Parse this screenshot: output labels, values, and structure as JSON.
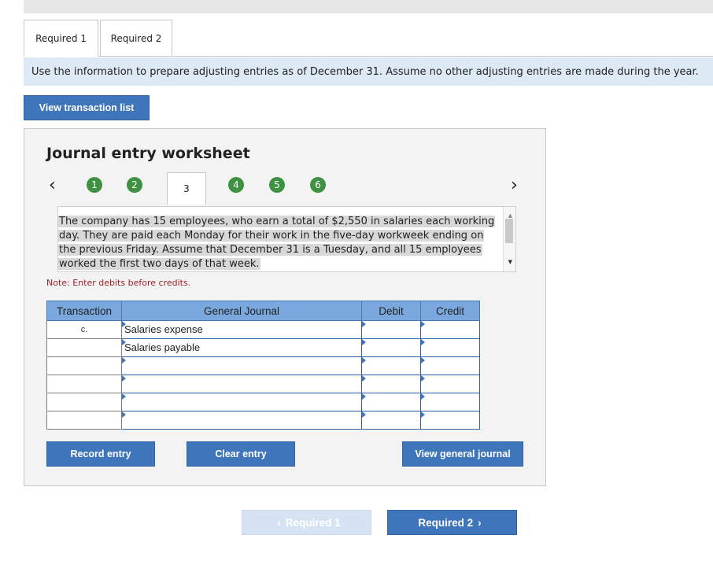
{
  "tabs": [
    {
      "label": "Required 1",
      "active": true
    },
    {
      "label": "Required 2",
      "active": false
    }
  ],
  "instructions": "Use the information to prepare adjusting entries as of December 31. Assume no other adjusting entries are made during the year.",
  "buttons": {
    "view_transaction_list": "View transaction list",
    "record_entry": "Record entry",
    "clear_entry": "Clear entry",
    "view_general_journal": "View general journal"
  },
  "worksheet": {
    "title": "Journal entry worksheet",
    "nav_left_icon": "chevron-left-icon",
    "nav_right_icon": "chevron-right-icon",
    "steps": [
      "1",
      "2",
      "3",
      "4",
      "5",
      "6"
    ],
    "active_step": "3",
    "step_color": "#3f9142",
    "description": "The company has 15 employees, who earn a total of $2,550 in salaries each working day. They are paid each Monday for their work in the five-day workweek ending on the previous Friday. Assume that December 31 is a Tuesday, and all 15 employees worked the first two days of that week.",
    "note": "Note: Enter debits before credits."
  },
  "journal": {
    "headers": [
      "Transaction",
      "General Journal",
      "Debit",
      "Credit"
    ],
    "rows": [
      {
        "transaction": "c.",
        "account": "Salaries expense",
        "debit": "",
        "credit": ""
      },
      {
        "transaction": "",
        "account": "Salaries payable",
        "debit": "",
        "credit": ""
      },
      {
        "transaction": "",
        "account": "",
        "debit": "",
        "credit": ""
      },
      {
        "transaction": "",
        "account": "",
        "debit": "",
        "credit": ""
      },
      {
        "transaction": "",
        "account": "",
        "debit": "",
        "credit": ""
      },
      {
        "transaction": "",
        "account": "",
        "debit": "",
        "credit": ""
      }
    ]
  },
  "footer_nav": {
    "prev_label": "Required 1",
    "next_label": "Required 2",
    "prev_icon": "chevron-left-icon",
    "next_icon": "chevron-right-icon"
  },
  "colors": {
    "accent": "#3f76bb",
    "header_fill": "#7aa7dd",
    "instruction_bg": "#dde9f5",
    "note_red": "#a3202a"
  }
}
